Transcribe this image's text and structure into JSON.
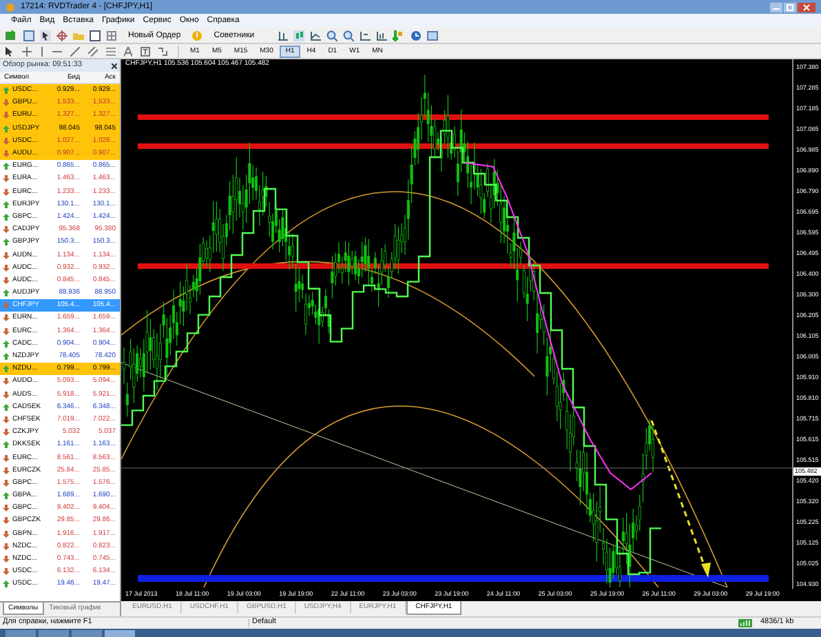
{
  "window": {
    "title": "17214: RVDTrader 4 - [CHFJPY,H1]"
  },
  "menu": [
    "Файл",
    "Вид",
    "Вставка",
    "Графики",
    "Сервис",
    "Окно",
    "Справка"
  ],
  "toolbar": {
    "new_order": "Новый Ордер",
    "experts": "Советники"
  },
  "timeframes": [
    {
      "label": "M1",
      "selected": false
    },
    {
      "label": "M5",
      "selected": false
    },
    {
      "label": "M15",
      "selected": false
    },
    {
      "label": "M30",
      "selected": false
    },
    {
      "label": "H1",
      "selected": true
    },
    {
      "label": "H4",
      "selected": false
    },
    {
      "label": "D1",
      "selected": false
    },
    {
      "label": "W1",
      "selected": false
    },
    {
      "label": "MN",
      "selected": false
    }
  ],
  "market_watch": {
    "title": "Обзор рынка: 09:51:33",
    "columns": [
      "Символ",
      "Бид",
      "Аск"
    ],
    "rows": [
      {
        "symbol": "USDC...",
        "bid": "0.929...",
        "ask": "0.929...",
        "kind": "up",
        "highlighted": true,
        "selected": false
      },
      {
        "symbol": "GBPU...",
        "bid": "1.533...",
        "ask": "1.533...",
        "kind": "down",
        "highlighted": true,
        "selected": false
      },
      {
        "symbol": "EURU...",
        "bid": "1.327...",
        "ask": "1.327...",
        "kind": "down",
        "highlighted": true,
        "selected": false
      },
      {
        "symbol": "USDJPY",
        "bid": "98.045",
        "ask": "98.045",
        "kind": "up",
        "highlighted": true,
        "selected": false
      },
      {
        "symbol": "USDC...",
        "bid": "1.027...",
        "ask": "1.028...",
        "kind": "down",
        "highlighted": true,
        "selected": false
      },
      {
        "symbol": "AUDU...",
        "bid": "0.907...",
        "ask": "0.907...",
        "kind": "down",
        "highlighted": true,
        "selected": false
      },
      {
        "symbol": "EURG...",
        "bid": "0.865...",
        "ask": "0.865...",
        "kind": "up",
        "highlighted": false,
        "selected": false
      },
      {
        "symbol": "EURA...",
        "bid": "1.463...",
        "ask": "1.463...",
        "kind": "down",
        "highlighted": false,
        "selected": false
      },
      {
        "symbol": "EURC...",
        "bid": "1.233...",
        "ask": "1.233...",
        "kind": "down",
        "highlighted": false,
        "selected": false
      },
      {
        "symbol": "EURJPY",
        "bid": "130.1...",
        "ask": "130.1...",
        "kind": "up",
        "highlighted": false,
        "selected": false
      },
      {
        "symbol": "GBPC...",
        "bid": "1.424...",
        "ask": "1.424...",
        "kind": "up",
        "highlighted": false,
        "selected": false
      },
      {
        "symbol": "CADJPY",
        "bid": "95.368",
        "ask": "95.380",
        "kind": "down",
        "highlighted": false,
        "selected": false
      },
      {
        "symbol": "GBPJPY",
        "bid": "150.3...",
        "ask": "150.3...",
        "kind": "up",
        "highlighted": false,
        "selected": false
      },
      {
        "symbol": "AUDN...",
        "bid": "1.134...",
        "ask": "1.134...",
        "kind": "down",
        "highlighted": false,
        "selected": false
      },
      {
        "symbol": "AUDC...",
        "bid": "0.932...",
        "ask": "0.932...",
        "kind": "down",
        "highlighted": false,
        "selected": false
      },
      {
        "symbol": "AUDC...",
        "bid": "0.845...",
        "ask": "0.845...",
        "kind": "down",
        "highlighted": false,
        "selected": false
      },
      {
        "symbol": "AUDJPY",
        "bid": "88.936",
        "ask": "88.950",
        "kind": "up",
        "highlighted": false,
        "selected": false
      },
      {
        "symbol": "CHFJPY",
        "bid": "105.4...",
        "ask": "105.4...",
        "kind": "down",
        "highlighted": false,
        "selected": true
      },
      {
        "symbol": "EURN...",
        "bid": "1.659...",
        "ask": "1.659...",
        "kind": "down",
        "highlighted": false,
        "selected": false
      },
      {
        "symbol": "EURC...",
        "bid": "1.364...",
        "ask": "1.364...",
        "kind": "down",
        "highlighted": false,
        "selected": false
      },
      {
        "symbol": "CADC...",
        "bid": "0.904...",
        "ask": "0.904...",
        "kind": "up",
        "highlighted": false,
        "selected": false
      },
      {
        "symbol": "NZDJPY",
        "bid": "78.405",
        "ask": "78.420",
        "kind": "up",
        "highlighted": false,
        "selected": false
      },
      {
        "symbol": "NZDU...",
        "bid": "0.799...",
        "ask": "0.799...",
        "kind": "up",
        "highlighted": true,
        "selected": false
      },
      {
        "symbol": "AUDO...",
        "bid": "5.093...",
        "ask": "5.094...",
        "kind": "down",
        "highlighted": false,
        "selected": false
      },
      {
        "symbol": "AUDS...",
        "bid": "5.918...",
        "ask": "5.921...",
        "kind": "down",
        "highlighted": false,
        "selected": false
      },
      {
        "symbol": "CADSEK",
        "bid": "6.346...",
        "ask": "6.348...",
        "kind": "up",
        "highlighted": false,
        "selected": false
      },
      {
        "symbol": "CHFSEK",
        "bid": "7.019...",
        "ask": "7.022...",
        "kind": "down",
        "highlighted": false,
        "selected": false
      },
      {
        "symbol": "CZKJPY",
        "bid": "5.032",
        "ask": "5.037",
        "kind": "down",
        "highlighted": false,
        "selected": false
      },
      {
        "symbol": "DKKSEK",
        "bid": "1.161...",
        "ask": "1.163...",
        "kind": "up",
        "highlighted": false,
        "selected": false
      },
      {
        "symbol": "EURC...",
        "bid": "8.561...",
        "ask": "8.563...",
        "kind": "down",
        "highlighted": false,
        "selected": false
      },
      {
        "symbol": "EURCZK",
        "bid": "25.84...",
        "ask": "25.85...",
        "kind": "down",
        "highlighted": false,
        "selected": false
      },
      {
        "symbol": "GBPC...",
        "bid": "1.575...",
        "ask": "1.576...",
        "kind": "down",
        "highlighted": false,
        "selected": false
      },
      {
        "symbol": "GBPA...",
        "bid": "1.689...",
        "ask": "1.690...",
        "kind": "up",
        "highlighted": false,
        "selected": false
      },
      {
        "symbol": "GBPC...",
        "bid": "9.402...",
        "ask": "9.404...",
        "kind": "down",
        "highlighted": false,
        "selected": false
      },
      {
        "symbol": "GBPCZK",
        "bid": "29.85...",
        "ask": "29.86...",
        "kind": "down",
        "highlighted": false,
        "selected": false
      },
      {
        "symbol": "GBPN...",
        "bid": "1.916...",
        "ask": "1.917...",
        "kind": "down",
        "highlighted": false,
        "selected": false
      },
      {
        "symbol": "NZDC...",
        "bid": "0.822...",
        "ask": "0.823...",
        "kind": "down",
        "highlighted": false,
        "selected": false
      },
      {
        "symbol": "NZDC...",
        "bid": "0.743...",
        "ask": "0.745...",
        "kind": "down",
        "highlighted": false,
        "selected": false
      },
      {
        "symbol": "USDC...",
        "bid": "6.132...",
        "ask": "6.134...",
        "kind": "down",
        "highlighted": false,
        "selected": false
      },
      {
        "symbol": "USDC...",
        "bid": "19.46...",
        "ask": "19.47...",
        "kind": "up",
        "highlighted": false,
        "selected": false
      }
    ],
    "tabs": [
      {
        "label": "Символы",
        "selected": true
      },
      {
        "label": "Тиковый график",
        "selected": false
      }
    ]
  },
  "chart": {
    "header": "CHFJPY,H1  105.536 105.604 105.467 105.482",
    "price_labels": [
      "107.380",
      "107.285",
      "107.185",
      "107.085",
      "106.985",
      "106.890",
      "106.790",
      "106.695",
      "106.595",
      "106.495",
      "106.400",
      "106.300",
      "106.205",
      "106.105",
      "106.005",
      "105.910",
      "105.810",
      "105.715",
      "105.615",
      "105.515",
      "105.420",
      "105.320",
      "105.225",
      "105.125",
      "105.025",
      "104.930"
    ],
    "current_price": "105.482",
    "time_labels": [
      "17 Jul 2013",
      "18 Jul 11:00",
      "19 Jul 03:00",
      "19 Jul 19:00",
      "22 Jul 11:00",
      "23 Jul 03:00",
      "23 Jul 19:00",
      "24 Jul 11:00",
      "25 Jul 03:00",
      "25 Jul 19:00",
      "26 Jul 11:00",
      "29 Jul 03:00",
      "29 Jul 19:00"
    ]
  },
  "chart_tabs": [
    {
      "label": "EURUSD,H1",
      "selected": false
    },
    {
      "label": "USDCHF,H1",
      "selected": false
    },
    {
      "label": "GBPUSD,H1",
      "selected": false
    },
    {
      "label": "USDJPY,H4",
      "selected": false
    },
    {
      "label": "EURJPY,H1",
      "selected": false
    },
    {
      "label": "CHFJPY,H1",
      "selected": true
    }
  ],
  "status_bar": {
    "help": "Для справки, нажмите F1",
    "profile": "Default",
    "traffic": "4836/1 kb"
  }
}
